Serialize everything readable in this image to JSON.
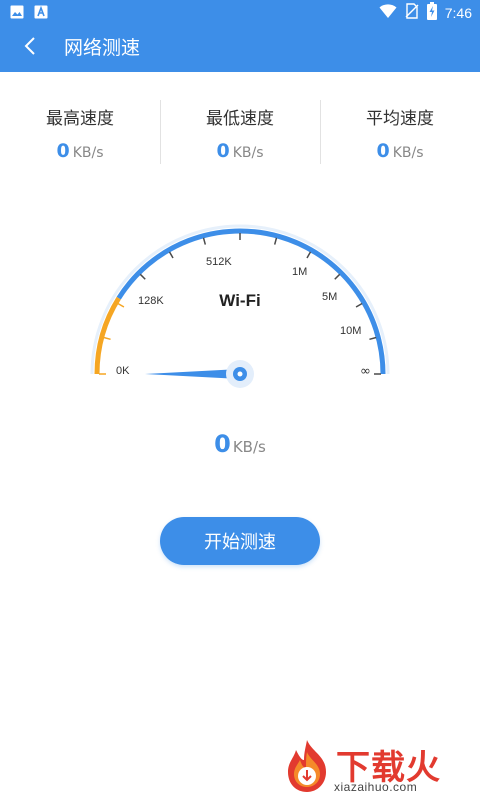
{
  "status_bar": {
    "time": "7:46",
    "icons": [
      "image-icon",
      "text-a-icon",
      "wifi-icon",
      "no-sim-icon",
      "battery-charging-icon"
    ]
  },
  "app_bar": {
    "title": "网络测速",
    "back_icon": "chevron-left-icon"
  },
  "stats": [
    {
      "label": "最高速度",
      "value": "0",
      "unit": "KB/s"
    },
    {
      "label": "最低速度",
      "value": "0",
      "unit": "KB/s"
    },
    {
      "label": "平均速度",
      "value": "0",
      "unit": "KB/s"
    }
  ],
  "gauge": {
    "network_label": "Wi-Fi",
    "ticks": [
      "0K",
      "128K",
      "512K",
      "1M",
      "5M",
      "10M",
      "∞"
    ],
    "level_fraction": 0,
    "colors": {
      "active": "#f5a623",
      "track": "#3d8ee8"
    }
  },
  "speed": {
    "value": "0",
    "unit": "KB/s"
  },
  "start_button": {
    "label": "开始测速"
  },
  "watermark": {
    "logo_text": "下载火",
    "site": "xiazaihuo.com"
  },
  "colors": {
    "primary": "#3d8ee8",
    "brand_red": "#e23a2f"
  }
}
